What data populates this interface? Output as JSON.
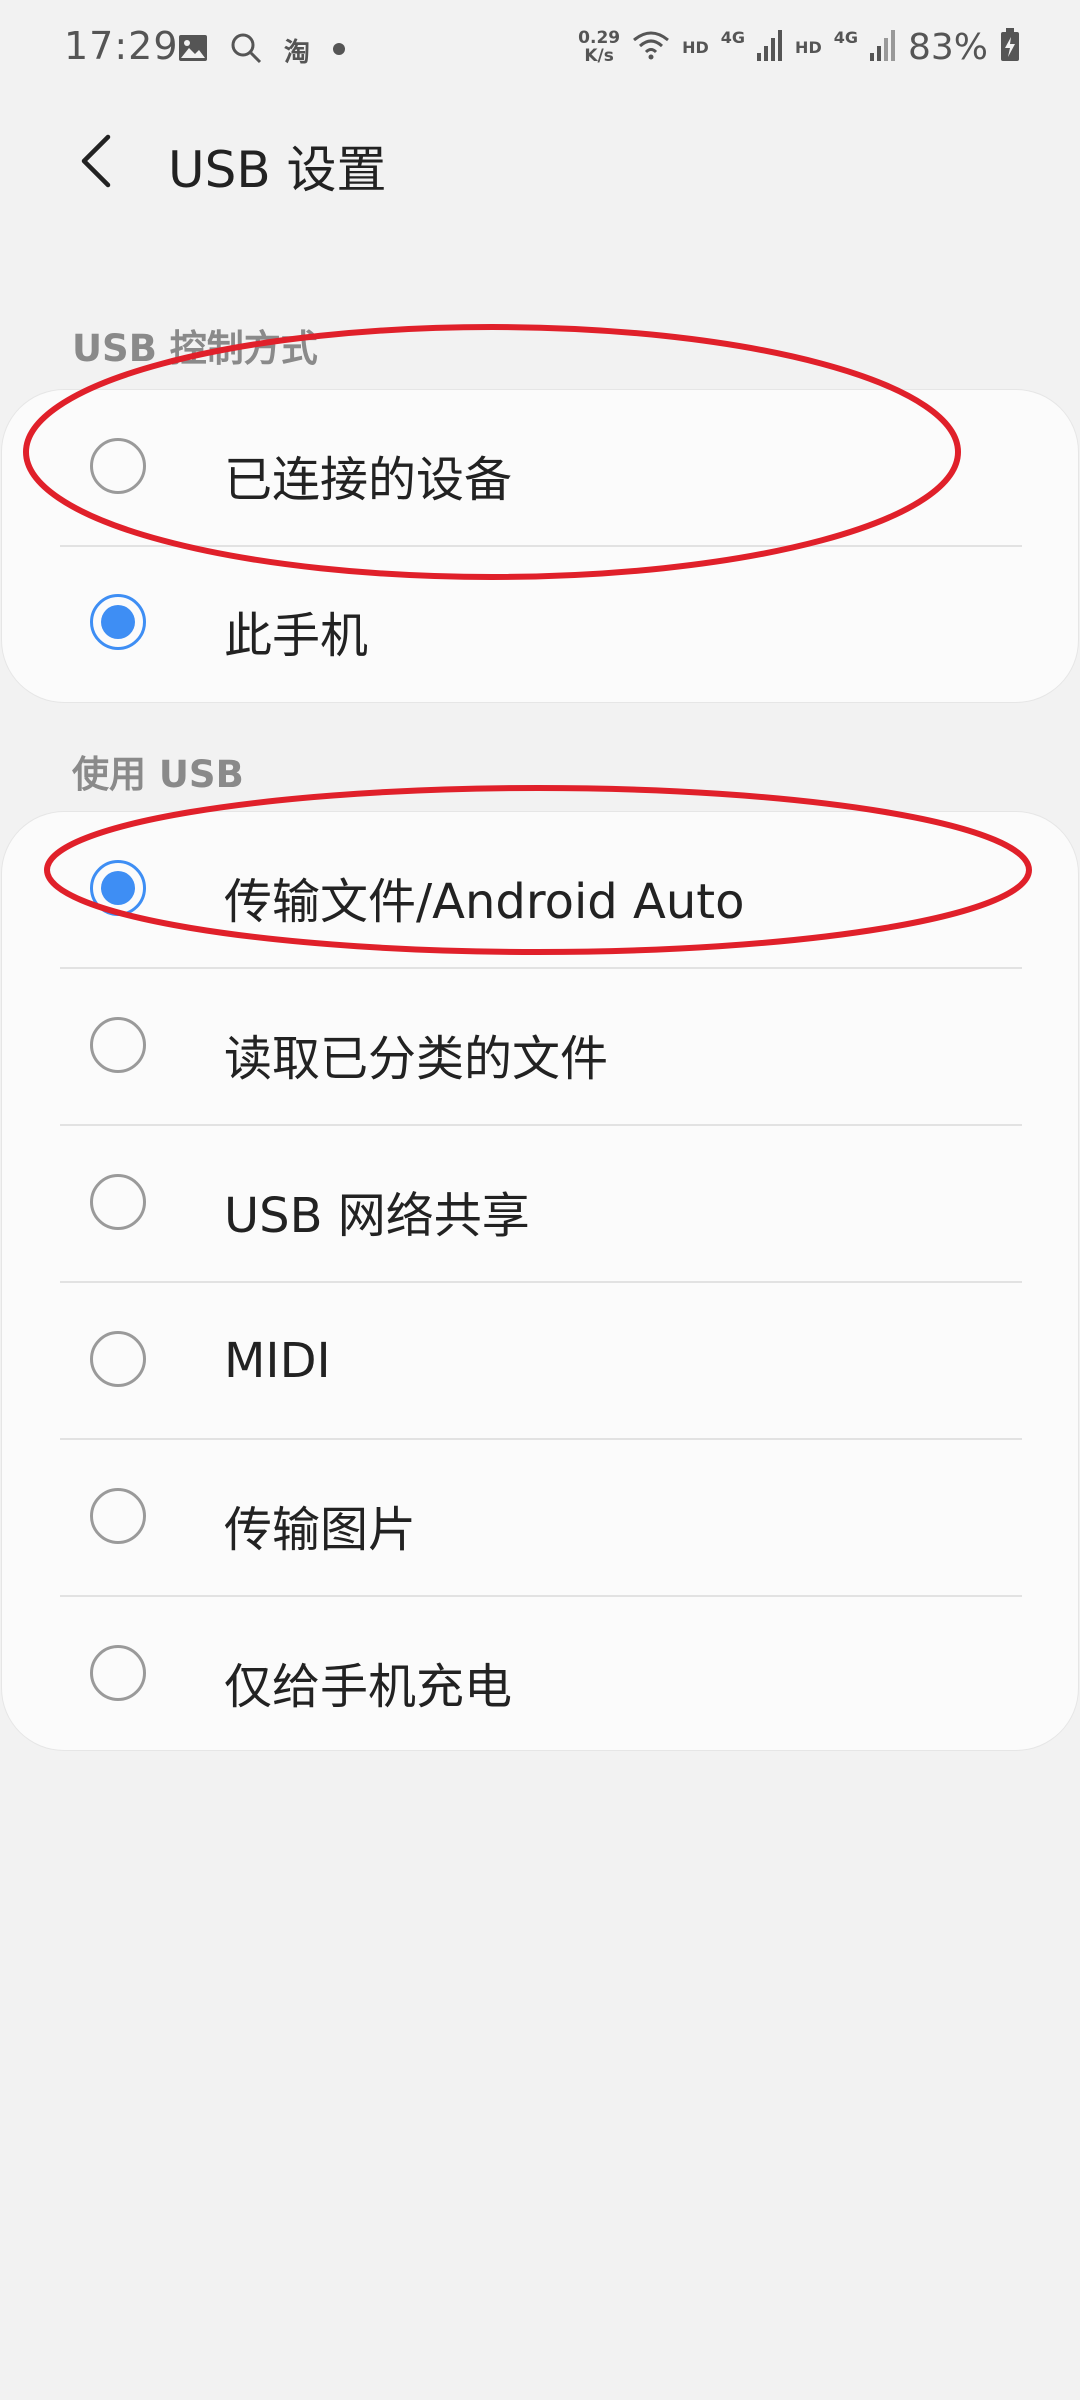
{
  "status_bar": {
    "time": "17:29",
    "speed_value": "0.29",
    "speed_unit": "K/s",
    "hd1": "HD",
    "net1": "4G",
    "hd2": "HD",
    "net2": "4G",
    "battery_percent": "83%",
    "taobao_glyph": "淘",
    "icons": [
      "gallery-icon",
      "search-icon",
      "taobao-icon",
      "dot-icon",
      "wifi-icon",
      "signal-icon",
      "battery-charging-icon"
    ]
  },
  "header": {
    "title": "USB 设置",
    "back_icon": "chevron-left-icon"
  },
  "sections": {
    "control": {
      "title": "USB 控制方式",
      "options": [
        {
          "label": "已连接的设备",
          "checked": false
        },
        {
          "label": "此手机",
          "checked": true
        }
      ]
    },
    "usage": {
      "title": "使用 USB",
      "options": [
        {
          "label": "传输文件/Android Auto",
          "checked": true
        },
        {
          "label": "读取已分类的文件",
          "checked": false
        },
        {
          "label": "USB 网络共享",
          "checked": false
        },
        {
          "label": "MIDI",
          "checked": false
        },
        {
          "label": "传输图片",
          "checked": false
        },
        {
          "label": "仅给手机充电",
          "checked": false
        }
      ]
    }
  },
  "colors": {
    "accent": "#3e8ef4",
    "annotation": "#e0202a",
    "background": "#f2f2f2",
    "card": "#fbfbfb"
  }
}
